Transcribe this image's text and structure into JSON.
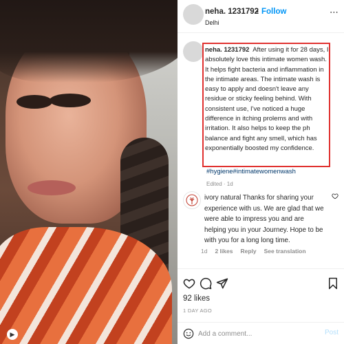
{
  "post": {
    "username": "neha. 1231792",
    "follow_label": "Follow",
    "location": "Delhi",
    "caption": "After using it for 28 days, I absolutely love this intimate women wash. It helps fight bacteria and inflammation in the intimate areas. The intimate wash is easy to apply and doesn't leave any residue or sticky feeling behind. With consistent use, I've noticed a huge difference in itching prolems and with irritation. It also helps to keep the ph balance and fight any smell, which has exponentially boosted my confidence.",
    "hashtags": "#hygiene#intimatewomenwash",
    "edited": "Edited · 1d"
  },
  "reply": {
    "username": "ivory natural",
    "text": "Thanks for sharing your experience with us. We are glad that we were able to impress you and are helping you in your Journey. Hope to be with you for a long long time.",
    "time": "1d",
    "likes": "2 likes",
    "reply_label": "Reply",
    "see_translation": "See translation"
  },
  "stats": {
    "likes": "92 likes",
    "time": "1 DAY AGO"
  },
  "comment_box": {
    "placeholder": "Add a comment...",
    "post_label": "Post"
  },
  "colors": {
    "follow": "#0095f6",
    "highlight": "#e0312f",
    "hashtag": "#00376b",
    "muted": "#8e8e8e"
  }
}
